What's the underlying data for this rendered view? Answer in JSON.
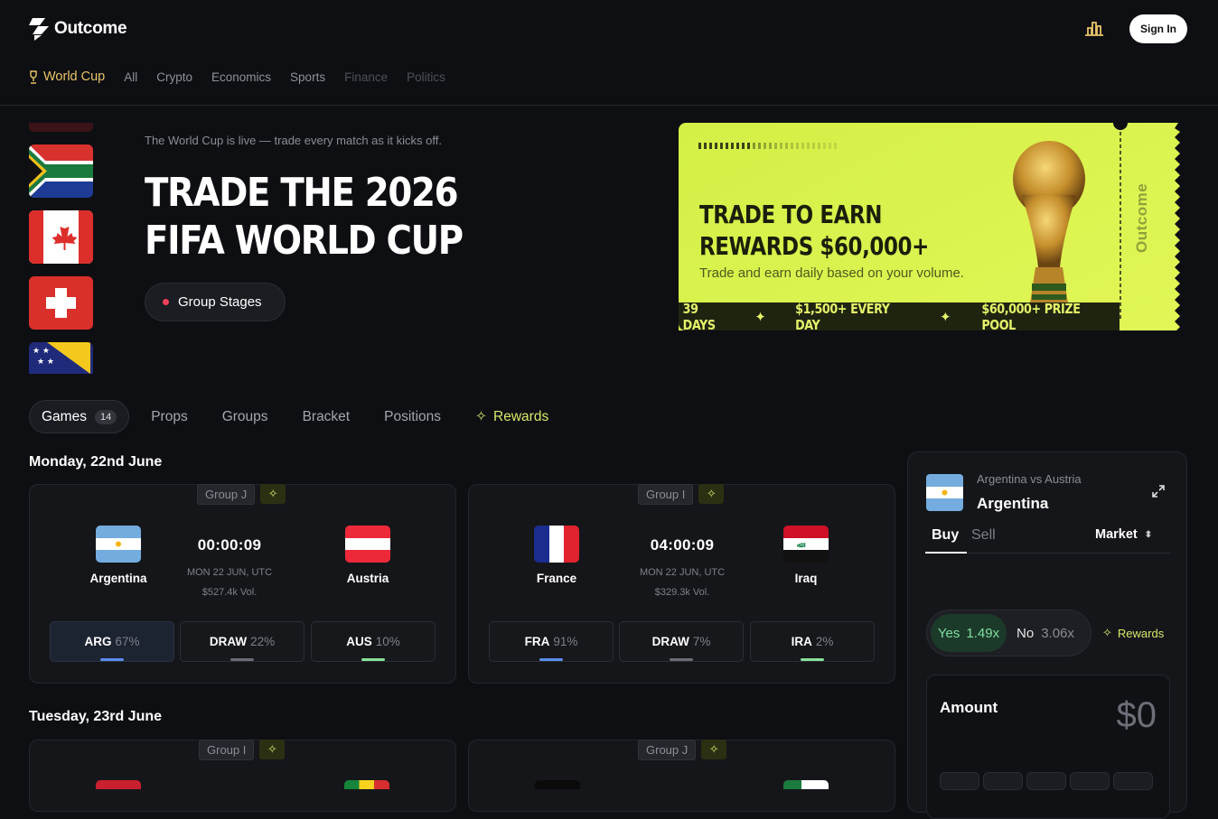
{
  "header": {
    "brand": "Outcome",
    "signin_label": "Sign In"
  },
  "nav": {
    "items": [
      "World Cup",
      "All",
      "Crypto",
      "Economics",
      "Sports",
      "Finance",
      "Politics"
    ]
  },
  "hero": {
    "subtitle": "The World Cup is live — trade every match as it kicks off.",
    "title_line1": "TRADE THE 2026",
    "title_line2": "FIFA WORLD CUP",
    "stage_label": "Group Stages"
  },
  "promo": {
    "title_line1": "TRADE TO EARN",
    "title_line2": "REWARDS $60,000+",
    "subtitle": "Trade and earn daily based on your volume.",
    "bar_items": [
      "39 DAYS",
      "$1,500+ EVERY DAY",
      "$60,000+ PRIZE POOL"
    ],
    "brand_vertical": "Outcome"
  },
  "tabs": {
    "games": "Games",
    "games_count": "14",
    "props": "Props",
    "groups": "Groups",
    "bracket": "Bracket",
    "positions": "Positions",
    "rewards": "Rewards"
  },
  "days": [
    "Monday, 22nd June",
    "Tuesday, 23rd June"
  ],
  "matches": [
    {
      "group": "Group J",
      "home": "Argentina",
      "away": "Austria",
      "clock": "00:00:09",
      "date": "MON 22 JUN, UTC",
      "volume": "$527.4k Vol.",
      "odds": [
        {
          "code": "ARG",
          "pct": "67%"
        },
        {
          "code": "DRAW",
          "pct": "22%"
        },
        {
          "code": "AUS",
          "pct": "10%"
        }
      ]
    },
    {
      "group": "Group I",
      "home": "France",
      "away": "Iraq",
      "clock": "04:00:09",
      "date": "MON 22 JUN, UTC",
      "volume": "$329.3k Vol.",
      "odds": [
        {
          "code": "FRA",
          "pct": "91%"
        },
        {
          "code": "DRAW",
          "pct": "7%"
        },
        {
          "code": "IRA",
          "pct": "2%"
        }
      ]
    },
    {
      "group": "Group I"
    },
    {
      "group": "Group J"
    }
  ],
  "trade_panel": {
    "match": "Argentina vs Austria",
    "selection": "Argentina",
    "buy": "Buy",
    "sell": "Sell",
    "order_type": "Market",
    "yes_label": "Yes",
    "yes_mult": "1.49x",
    "no_label": "No",
    "no_mult": "3.06x",
    "rewards": "Rewards",
    "amount_label": "Amount",
    "amount_value": "$0"
  },
  "colors": {
    "accent_yellow": "#e9c46a",
    "promo_lime": "#d9f24a",
    "yes_green": "#7fe0a0"
  }
}
